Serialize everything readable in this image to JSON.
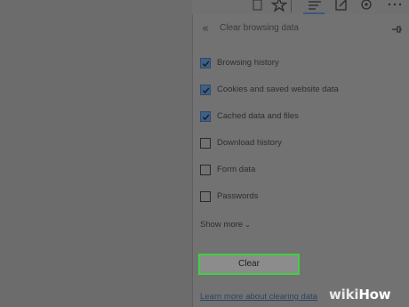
{
  "panel": {
    "title": "Clear browsing data",
    "options": [
      {
        "label": "Browsing history",
        "checked": true
      },
      {
        "label": "Cookies and saved website data",
        "checked": true
      },
      {
        "label": "Cached data and files",
        "checked": true
      },
      {
        "label": "Download history",
        "checked": false
      },
      {
        "label": "Form data",
        "checked": false
      },
      {
        "label": "Passwords",
        "checked": false
      }
    ],
    "show_more_label": "Show more",
    "clear_label": "Clear",
    "learn_more_label": "Learn more about clearing data"
  },
  "colors": {
    "checkbox_checked": "#3f5f86",
    "clear_highlight": "#3fd13f",
    "link": "#2d4463"
  },
  "watermark": {
    "prefix": "wiki",
    "suffix": "How"
  }
}
